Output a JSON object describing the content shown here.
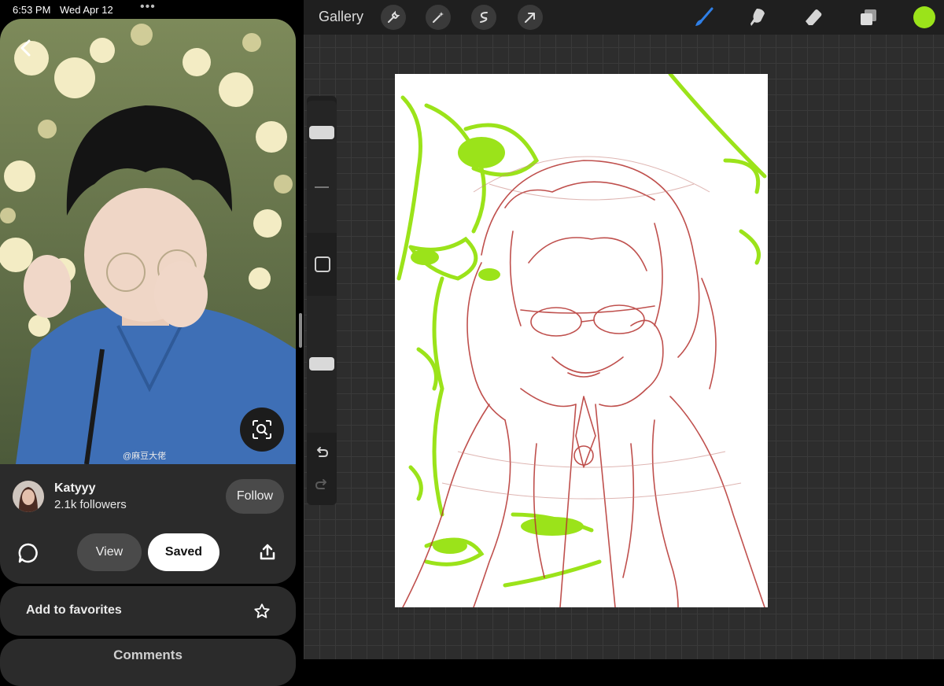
{
  "status_bar": {
    "time": "6:53 PM",
    "date": "Wed Apr 12",
    "dots": "•••"
  },
  "pin": {
    "photo_icon": "photo-of-person",
    "watermark": "@麻豆大佬",
    "creator": {
      "name": "Katyyy",
      "followers": "2.1k followers"
    },
    "follow_label": "Follow",
    "view_label": "View",
    "saved_label": "Saved",
    "favorites_label": "Add to favorites",
    "comments_label": "Comments"
  },
  "procreate": {
    "gallery_label": "Gallery",
    "tools": [
      "wrench-icon",
      "magic-wand-icon",
      "selection-icon",
      "transform-arrow-icon",
      "brush-icon",
      "smudge-icon",
      "eraser-icon",
      "layers-icon"
    ],
    "current_color": "#9be31a",
    "sketch_colors": {
      "lines": "#b5322f",
      "flowers": "#9be31a"
    }
  }
}
